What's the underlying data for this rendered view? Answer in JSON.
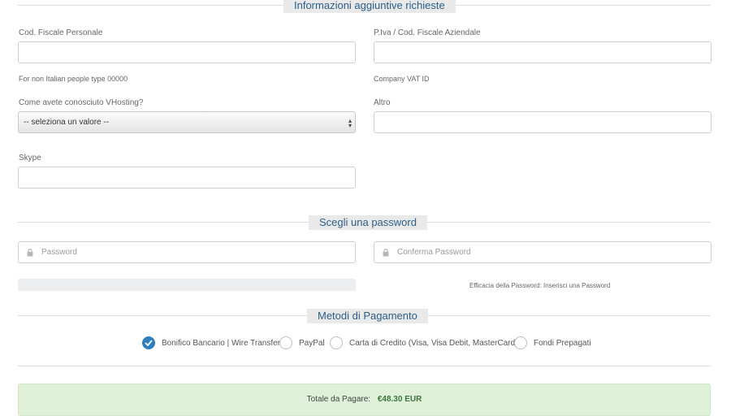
{
  "sections": {
    "additional_info": "Informazioni aggiuntive richieste",
    "password": "Scegli una password",
    "payment": "Metodi di Pagamento"
  },
  "fields": {
    "cod_fiscale": {
      "label": "Cod. Fiscale Personale",
      "value": "",
      "help": "For non Italian people type 00000"
    },
    "piva": {
      "label": "P.Iva / Cod. Fiscale Aziendale",
      "value": "",
      "help": "Company VAT ID"
    },
    "how_known": {
      "label": "Come avete conosciuto VHosting?",
      "selected": "-- seleziona un valore --"
    },
    "altro": {
      "label": "Altro",
      "value": ""
    },
    "skype": {
      "label": "Skype",
      "value": ""
    }
  },
  "password": {
    "placeholder": "Password",
    "confirm_placeholder": "Conferma Password",
    "strength_text": "Efficacia della Password: Inserisci una Password",
    "strength_level": 0
  },
  "payment_methods": [
    {
      "label": "Bonifico Bancario | Wire Transfer",
      "checked": true
    },
    {
      "label": "PayPal",
      "checked": false
    },
    {
      "label": "Carta di Credito (Visa, Visa Debit, MasterCard)",
      "checked": false
    },
    {
      "label": "Fondi Prepagati",
      "checked": false
    }
  ],
  "total": {
    "label": "Totale da Pagare:",
    "amount": "€48.30 EUR"
  },
  "colors": {
    "accent": "#2f7ebf",
    "section_title": "#2a5f8a",
    "total_bg": "#dff0d8",
    "total_amount": "#3c763d"
  },
  "icons": {
    "lock": "lock-icon",
    "check": "check-icon",
    "select_arrows": "select-arrows-icon"
  }
}
